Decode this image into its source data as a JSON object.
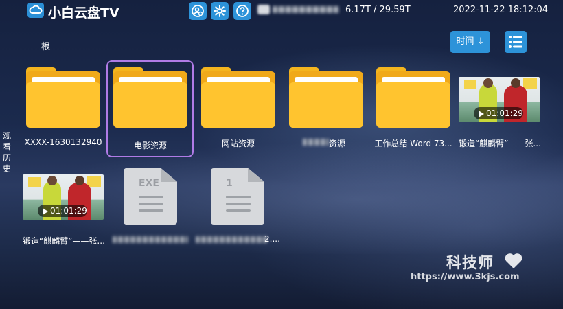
{
  "header": {
    "app_title": "小白云盘TV",
    "storage": "6.17T / 29.59T",
    "datetime": "2022-11-22 18:12:04",
    "icons": [
      "cloud-logo-icon",
      "account-switch-icon",
      "settings-gear-icon",
      "help-question-icon"
    ]
  },
  "toolbar": {
    "breadcrumb": "根",
    "sort_label": "时间 ↓",
    "view_icon": "list-view-icon"
  },
  "sidebar": {
    "history_label": "观看历史"
  },
  "items": [
    {
      "type": "folder",
      "label": "XXXX-1630132940"
    },
    {
      "type": "folder",
      "label": "电影资源",
      "selected": true
    },
    {
      "type": "folder",
      "label": "网站资源"
    },
    {
      "type": "folder",
      "label": "资源"
    },
    {
      "type": "folder",
      "label": "工作总结 Word 73..."
    },
    {
      "type": "video",
      "label": "锻造“麒麟臂”——张...",
      "duration": "01:01:29"
    },
    {
      "type": "video",
      "label": "锻造“麒麟臂”——张...",
      "duration": "01:01:29"
    },
    {
      "type": "file",
      "label": "",
      "badge": "EXE"
    },
    {
      "type": "file",
      "label": "2....",
      "badge": "1"
    }
  ],
  "watermark": {
    "name": "科技师",
    "url": "https://www.3kjs.com"
  },
  "colors": {
    "accent": "#2d93d9",
    "folder": "#ffc42f",
    "selection": "#b07be6"
  }
}
